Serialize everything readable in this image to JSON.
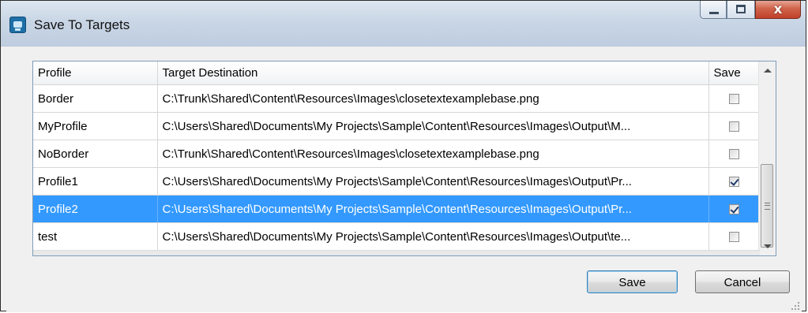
{
  "window": {
    "title": "Save To Targets",
    "controls": [
      "minimize",
      "maximize",
      "close"
    ],
    "close_glyph": "x"
  },
  "table": {
    "columns": [
      "Profile",
      "Target Destination",
      "Save"
    ],
    "rows": [
      {
        "profile": "Border",
        "destination": "C:\\Trunk\\Shared\\Content\\Resources\\Images\\closetextexamplebase.png",
        "save": false,
        "selected": false
      },
      {
        "profile": "MyProfile",
        "destination": "C:\\Users\\Shared\\Documents\\My Projects\\Sample\\Content\\Resources\\Images\\Output\\M...",
        "save": false,
        "selected": false
      },
      {
        "profile": "NoBorder",
        "destination": "C:\\Trunk\\Shared\\Content\\Resources\\Images\\closetextexamplebase.png",
        "save": false,
        "selected": false
      },
      {
        "profile": "Profile1",
        "destination": "C:\\Users\\Shared\\Documents\\My Projects\\Sample\\Content\\Resources\\Images\\Output\\Pr...",
        "save": true,
        "selected": false
      },
      {
        "profile": "Profile2",
        "destination": "C:\\Users\\Shared\\Documents\\My Projects\\Sample\\Content\\Resources\\Images\\Output\\Pr...",
        "save": true,
        "selected": true
      },
      {
        "profile": "test",
        "destination": "C:\\Users\\Shared\\Documents\\My Projects\\Sample\\Content\\Resources\\Images\\Output\\te...",
        "save": false,
        "selected": false
      }
    ]
  },
  "buttons": {
    "save_label": "Save",
    "cancel_label": "Cancel"
  },
  "colors": {
    "selection": "#3399ff",
    "close_button": "#c0402a"
  },
  "icons": {
    "app": "app-icon",
    "minimize": "minimize-icon",
    "maximize": "maximize-icon",
    "close": "close-icon"
  }
}
